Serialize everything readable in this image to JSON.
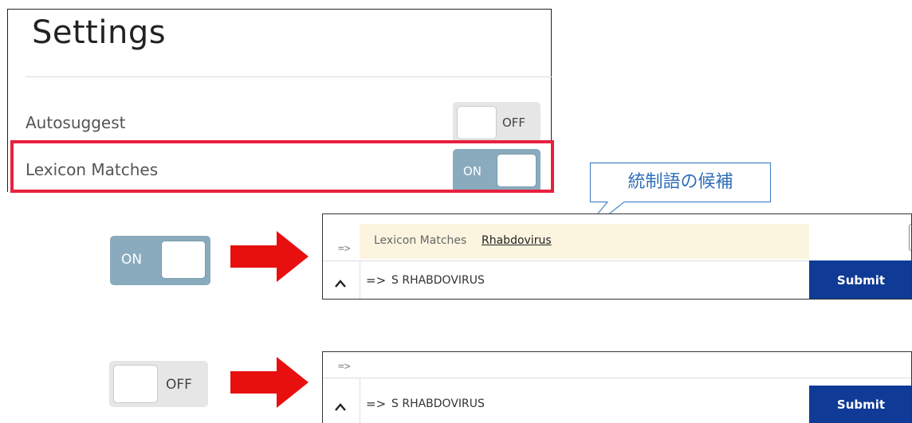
{
  "settings": {
    "title": "Settings",
    "autosuggest": {
      "label": "Autosuggest",
      "state": "OFF"
    },
    "lexicon_matches": {
      "label": "Lexicon Matches",
      "state": "ON"
    }
  },
  "highlight_color": "#e8203f",
  "callout": {
    "text": "統制語の候補"
  },
  "demo_on": {
    "toggle_label": "ON",
    "prompt_arrow": "=>",
    "lexicon_label": "Lexicon Matches",
    "lexicon_term": "Rhabdovirus",
    "query_arrow": "=>",
    "query_text": "S RHABDOVIRUS",
    "submit_label": "Submit"
  },
  "demo_off": {
    "toggle_label": "OFF",
    "prompt_arrow": "=>",
    "query_arrow": "=>",
    "query_text": "S RHABDOVIRUS",
    "submit_label": "Submit"
  },
  "colors": {
    "toggle_on": "#8aabbd",
    "toggle_off": "#e6e6e6",
    "submit": "#0f3a96",
    "lexicon_bar": "#fbf5e0",
    "arrow": "#e8100f",
    "callout_text": "#2f6fba"
  },
  "icons": [
    "caret-up-icon",
    "right-arrow-icon",
    "callout-bubble"
  ]
}
